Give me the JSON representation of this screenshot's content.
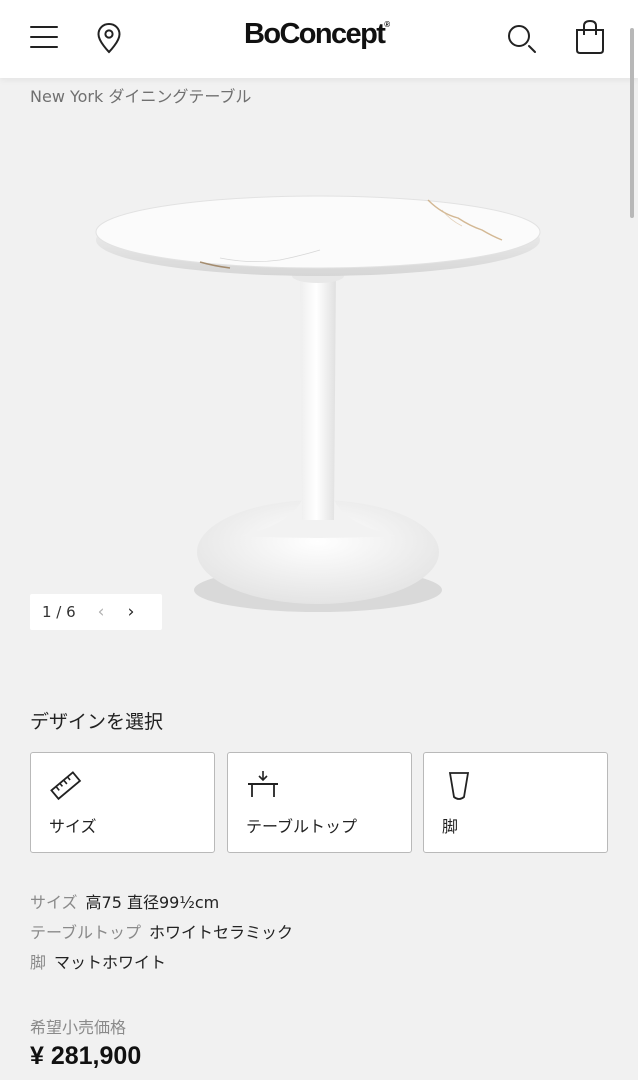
{
  "header": {
    "menu_icon": "hamburger-menu-icon",
    "store_icon": "location-pin-icon",
    "brand": "BoConcept",
    "brand_mark": "®",
    "search_icon": "search-icon",
    "cart_icon": "shopping-bag-icon"
  },
  "product": {
    "subtitle": "New York ダイニングテーブル",
    "image_counter": "1 / 6",
    "prev_label": "‹",
    "next_label": "›"
  },
  "design": {
    "title": "デザインを選択",
    "options": [
      {
        "label": "サイズ",
        "icon": "ruler-icon"
      },
      {
        "label": "テーブルトップ",
        "icon": "tabletop-icon"
      },
      {
        "label": "脚",
        "icon": "table-leg-icon"
      }
    ]
  },
  "specs": [
    {
      "key": "サイズ",
      "value": "高75 直径99½cm"
    },
    {
      "key": "テーブルトップ",
      "value": "ホワイトセラミック"
    },
    {
      "key": "脚",
      "value": "マットホワイト"
    }
  ],
  "price": {
    "label": "希望小売価格",
    "value": "¥ 281,900"
  },
  "colors": {
    "background": "#f1f1f1",
    "header": "#ffffff",
    "text": "#222222",
    "muted": "#8a8a8a"
  }
}
